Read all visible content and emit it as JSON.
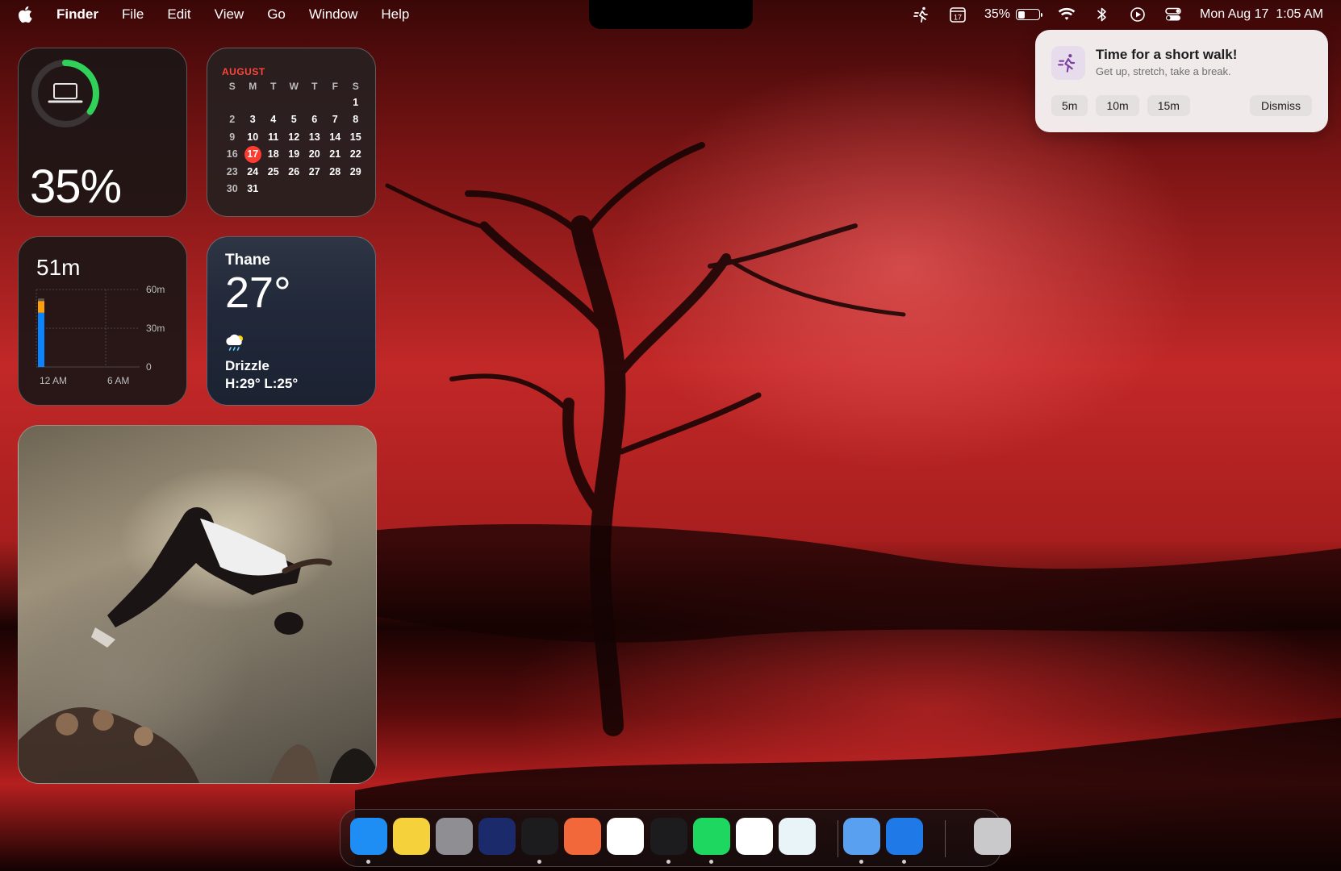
{
  "menubar": {
    "app": "Finder",
    "menus": [
      "File",
      "Edit",
      "View",
      "Go",
      "Window",
      "Help"
    ],
    "calendar_icon_day": "17",
    "battery_percent": "35%",
    "battery_level": 0.35,
    "datetime": "Mon Aug 17  1:05 AM"
  },
  "widgets": {
    "battery": {
      "percent_text": "35%",
      "level": 0.35
    },
    "calendar": {
      "month": "AUGUST",
      "weekdays": [
        "S",
        "M",
        "T",
        "W",
        "T",
        "F",
        "S"
      ],
      "first_weekday_index": 6,
      "days_in_month": 31,
      "today": 17
    },
    "screen_time": {
      "total": "51m",
      "y_ticks": [
        "60m",
        "30m",
        "0"
      ],
      "x_ticks": [
        "12 AM",
        "6 AM"
      ],
      "bar_minutes": 51,
      "bar_blue_minutes": 42,
      "y_max_minutes": 60
    },
    "weather": {
      "city": "Thane",
      "temp": "27°",
      "condition": "Drizzle",
      "hilo": "H:29° L:25°"
    }
  },
  "notification": {
    "title": "Time for a short walk!",
    "body": "Get up, stretch, take a break.",
    "actions": [
      "5m",
      "10m",
      "15m"
    ],
    "dismiss": "Dismiss"
  },
  "dock": {
    "apps": [
      {
        "name": "finder",
        "color": "#1e8ef5",
        "running": true
      },
      {
        "name": "notes",
        "color": "#f5d23c",
        "running": false
      },
      {
        "name": "system-settings",
        "color": "#8e8e93",
        "running": false
      },
      {
        "name": "finder-alt",
        "color": "#1a2a6a",
        "running": false
      },
      {
        "name": "screen-capture",
        "color": "#1c1c1e",
        "running": true
      },
      {
        "name": "pen-app",
        "color": "#f3683a",
        "running": false
      },
      {
        "name": "vscode",
        "color": "#ffffff",
        "running": false
      },
      {
        "name": "zed",
        "color": "#1c1c1e",
        "running": true
      },
      {
        "name": "spotify",
        "color": "#1ed760",
        "running": true
      },
      {
        "name": "notion",
        "color": "#ffffff",
        "running": false
      },
      {
        "name": "lens-app",
        "color": "#e8f4f8",
        "running": false
      },
      {
        "name": "disk-utility",
        "color": "#5aa0f0",
        "running": true
      },
      {
        "name": "xcode",
        "color": "#1f7ae8",
        "running": true
      },
      {
        "name": "trash",
        "color": "#c9c9cc",
        "running": false
      }
    ]
  }
}
